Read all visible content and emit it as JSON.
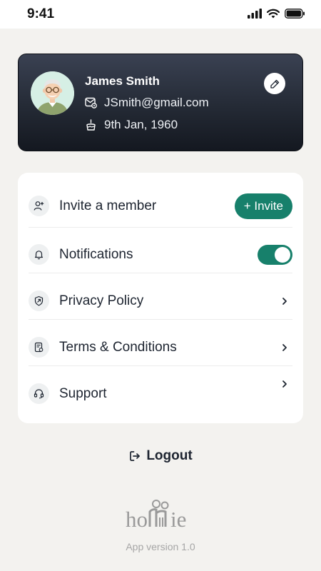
{
  "status_bar": {
    "time": "9:41"
  },
  "profile": {
    "name": "James Smith",
    "email": "JSmith@gmail.com",
    "dob": "9th Jan, 1960"
  },
  "menu": {
    "items": [
      {
        "label": "Invite a member",
        "icon": "add-user-icon",
        "action_label": "+ Invite"
      },
      {
        "label": "Notifications",
        "icon": "bell-icon",
        "toggle_on": true
      },
      {
        "label": "Privacy Policy",
        "icon": "shield-icon"
      },
      {
        "label": "Terms & Conditions",
        "icon": "document-icon"
      },
      {
        "label": "Support",
        "icon": "headset-icon"
      }
    ]
  },
  "logout_label": "Logout",
  "brand": {
    "name": "homie"
  },
  "version": "App version 1.0",
  "colors": {
    "accent": "#17806b",
    "card_dark": "#242a35",
    "background": "#f3f2ef"
  }
}
